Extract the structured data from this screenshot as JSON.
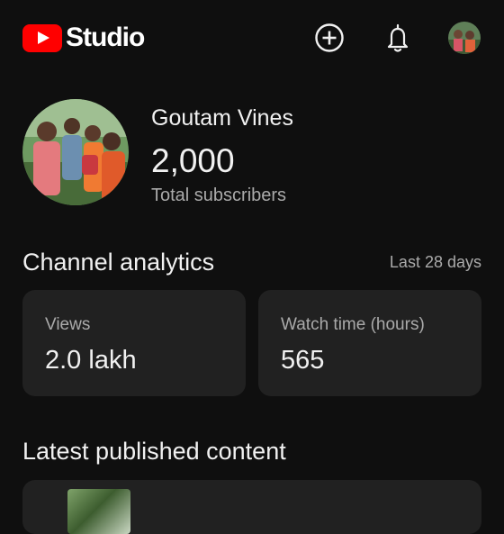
{
  "header": {
    "brand": "Studio",
    "icons": [
      "create-icon",
      "notifications-icon",
      "account-avatar"
    ]
  },
  "channel": {
    "name": "Goutam Vines",
    "subscriber_count": "2,000",
    "subscriber_label": "Total subscribers"
  },
  "analytics": {
    "title": "Channel analytics",
    "range": "Last 28 days",
    "cards": [
      {
        "label": "Views",
        "value": "2.0 lakh"
      },
      {
        "label": "Watch time (hours)",
        "value": "565"
      }
    ]
  },
  "latest": {
    "title": "Latest published content"
  },
  "colors": {
    "background": "#0f0f0f",
    "card": "#212121",
    "brand_red": "#ff0000",
    "secondary_text": "#aaaaaa"
  }
}
